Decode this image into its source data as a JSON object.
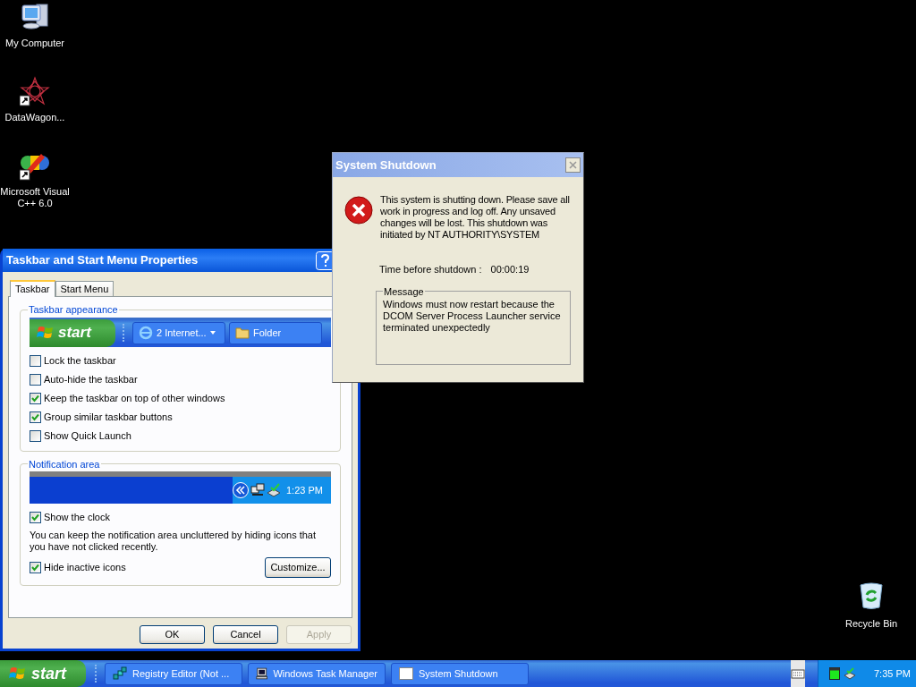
{
  "desktop_icons": [
    {
      "label": "My Computer",
      "kind": "computer"
    },
    {
      "label": "DataWagon...",
      "kind": "star"
    },
    {
      "label": "Microsoft Visual C++ 6.0",
      "kind": "vcpp"
    }
  ],
  "recycle_bin": {
    "label": "Recycle Bin"
  },
  "properties_window": {
    "title": "Taskbar and Start Menu Properties",
    "tabs": [
      {
        "label": "Taskbar",
        "selected": true
      },
      {
        "label": "Start Menu",
        "selected": false
      }
    ],
    "taskbar_appearance": {
      "title": "Taskbar appearance",
      "preview": {
        "start": "start",
        "buttons": [
          {
            "label": "2 Internet...",
            "kind": "browser",
            "dropdown": true
          },
          {
            "label": "Folder",
            "kind": "folder",
            "dropdown": false
          }
        ]
      },
      "options": [
        {
          "label": "Lock the taskbar",
          "checked": false
        },
        {
          "label": "Auto-hide the taskbar",
          "checked": false
        },
        {
          "label": "Keep the taskbar on top of other windows",
          "checked": true
        },
        {
          "label": "Group similar taskbar buttons",
          "checked": true
        },
        {
          "label": "Show Quick Launch",
          "checked": false
        }
      ]
    },
    "notification_area": {
      "title": "Notification area",
      "preview_clock": "1:23 PM",
      "show_clock": {
        "label": "Show the clock",
        "checked": true
      },
      "description": "You can keep the notification area uncluttered by hiding icons that you have not clicked recently.",
      "hide_inactive": {
        "label": "Hide inactive icons",
        "checked": true
      },
      "customize_button": "Customize..."
    },
    "buttons": [
      {
        "label": "OK",
        "disabled": false
      },
      {
        "label": "Cancel",
        "disabled": false
      },
      {
        "label": "Apply",
        "disabled": true
      }
    ]
  },
  "shutdown_dialog": {
    "title": "System Shutdown",
    "message": "This system is shutting down. Please save all work in progress and log off. Any unsaved changes will be lost. This shutdown was initiated by NT AUTHORITY\\SYSTEM",
    "time_label": "Time before shutdown :",
    "time_value": "00:00:19",
    "group_title": "Message",
    "group_text": "Windows must now restart because the DCOM Server Process Launcher service terminated unexpectedly"
  },
  "taskbar": {
    "start": "start",
    "tasks": [
      {
        "label": "Registry Editor (Not ...",
        "kind": "registry"
      },
      {
        "label": "Windows Task Manager",
        "kind": "taskmgr"
      },
      {
        "label": "System Shutdown",
        "kind": "window"
      }
    ],
    "clock": "7:35 PM"
  }
}
